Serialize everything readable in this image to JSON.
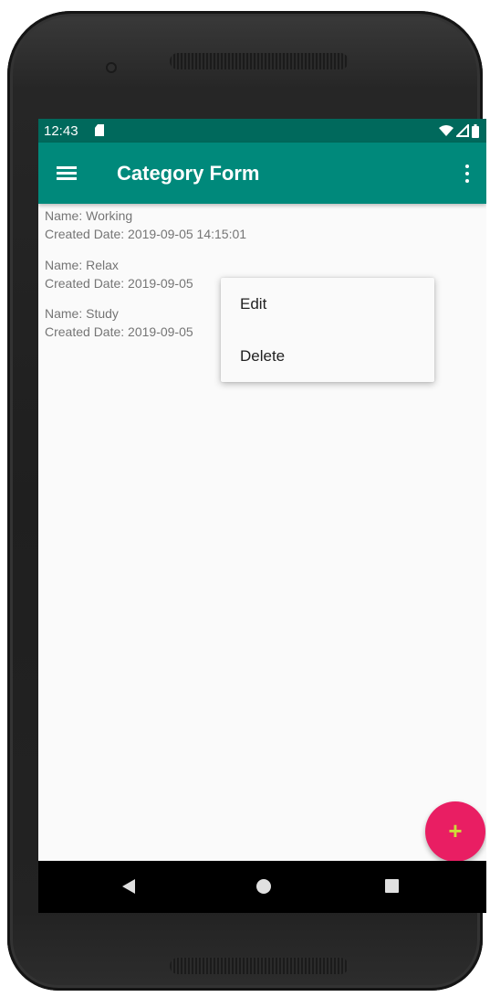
{
  "status_bar": {
    "time": "12:43",
    "icons": [
      "sd-card-icon",
      "wifi-icon",
      "signal-icon",
      "battery-icon"
    ]
  },
  "app_bar": {
    "title": "Category Form",
    "icons": [
      "menu-icon",
      "overflow-menu-icon"
    ]
  },
  "categories": [
    {
      "name": "Name: Working",
      "created": "Created Date: 2019-09-05 14:15:01"
    },
    {
      "name": "Name: Relax",
      "created": "Created Date: 2019-09-05"
    },
    {
      "name": "Name: Study",
      "created": "Created Date: 2019-09-05"
    }
  ],
  "context_menu": {
    "items": [
      "Edit",
      "Delete"
    ]
  },
  "fab": {
    "label": "+",
    "icon": "add-icon"
  },
  "nav_bar": {
    "icons": [
      "back-icon",
      "home-icon",
      "recents-icon"
    ]
  },
  "colors": {
    "status_bar": "#00695c",
    "app_bar": "#00897b",
    "fab": "#e91e63",
    "fab_icon": "#cddc39",
    "list_text": "#757575"
  }
}
